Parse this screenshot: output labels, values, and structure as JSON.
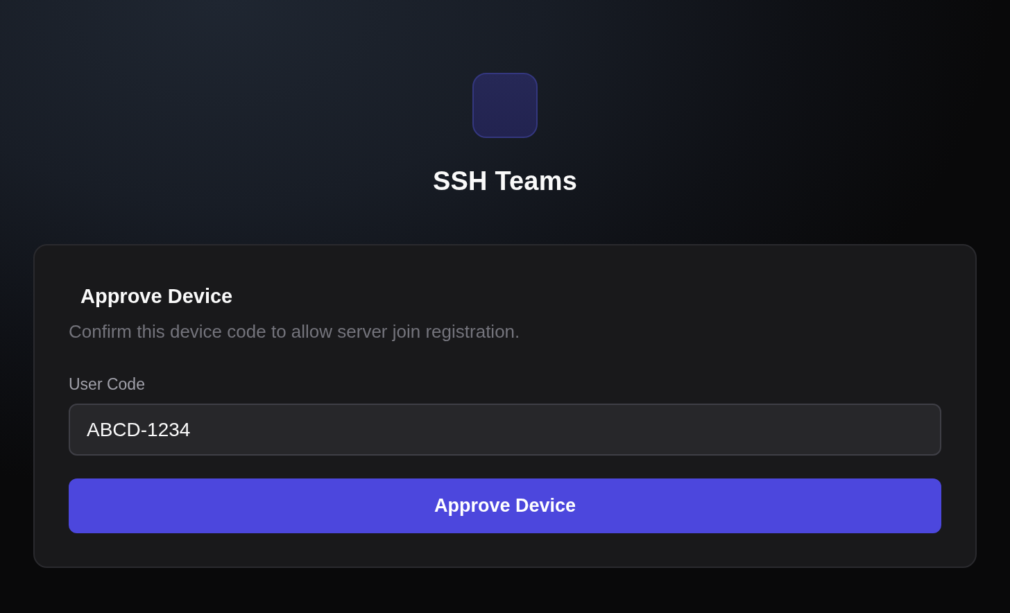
{
  "app": {
    "title": "SSH Teams"
  },
  "card": {
    "title": "Approve Device",
    "description": "Confirm this device code to allow server join registration.",
    "field": {
      "label": "User Code",
      "value": "ABCD-1234"
    },
    "button": {
      "label": "Approve Device"
    }
  }
}
